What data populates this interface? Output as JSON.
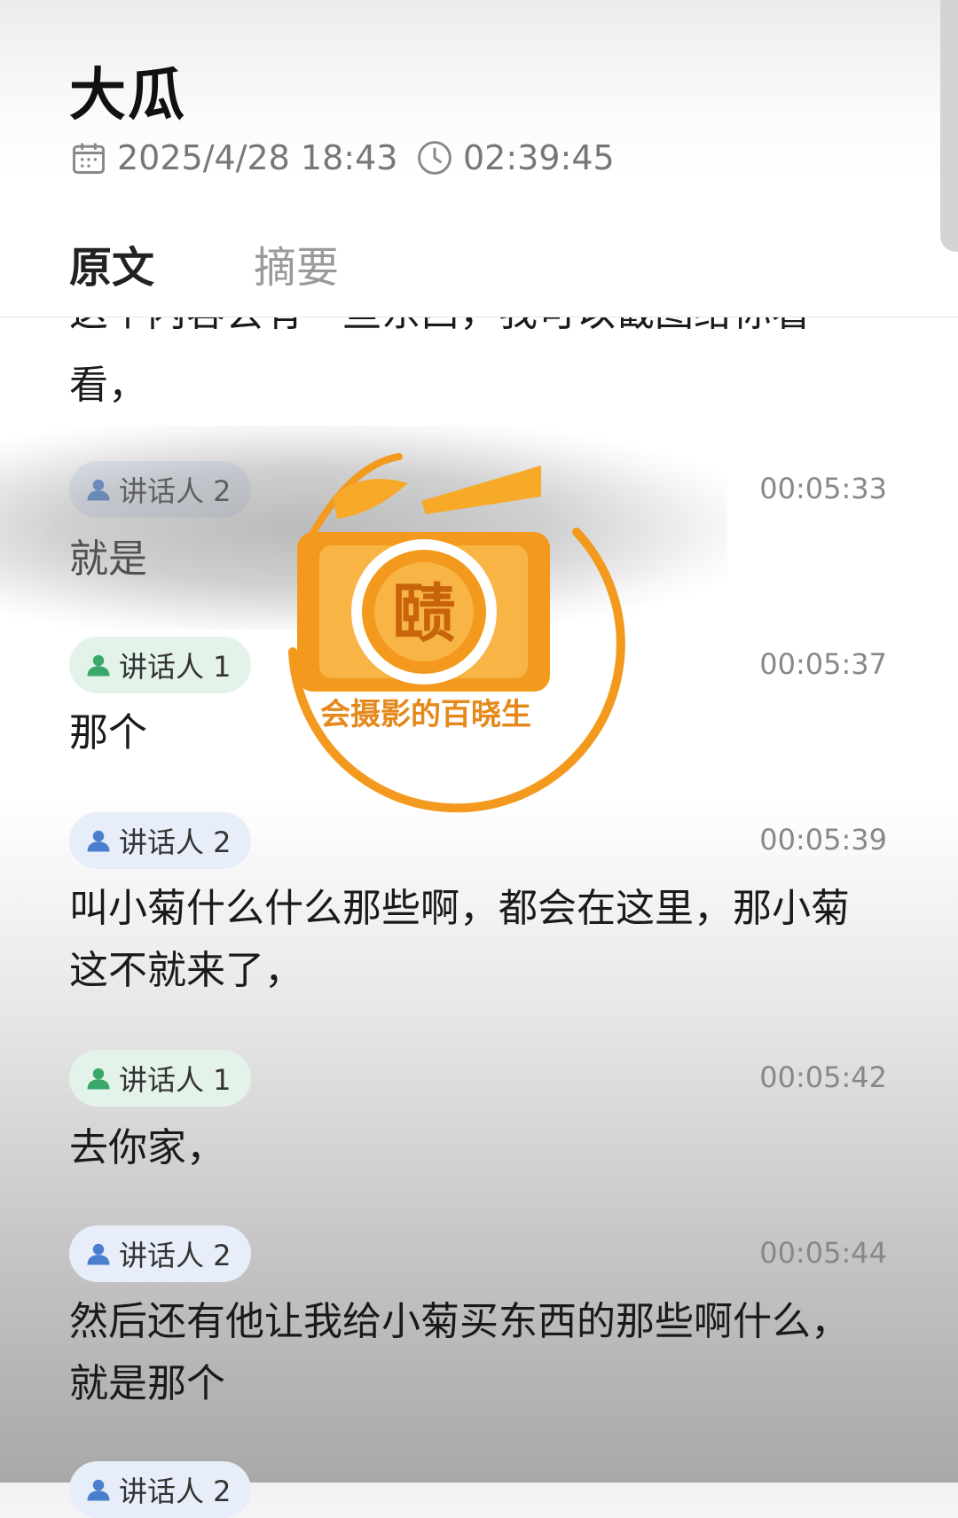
{
  "header": {
    "title": "大瓜",
    "datetime": "2025/4/28 18:43",
    "duration": "02:39:45"
  },
  "tabs": [
    {
      "label": "原文",
      "active": true
    },
    {
      "label": "摘要",
      "active": false
    }
  ],
  "transcript": {
    "cut_top_text": "这个内容会有一些东西，我可以截图给你看",
    "first_text": "看，",
    "entries": [
      {
        "speaker": "讲话人 2",
        "time": "00:05:33",
        "text": "就是"
      },
      {
        "speaker": "讲话人 1",
        "time": "00:05:37",
        "text": "那个"
      },
      {
        "speaker": "讲话人 2",
        "time": "00:05:39",
        "text": "叫小菊什么什么那些啊，都会在这里，那小菊这不就来了，"
      },
      {
        "speaker": "讲话人 1",
        "time": "00:05:42",
        "text": "去你家，"
      },
      {
        "speaker": "讲话人 2",
        "time": "00:05:44",
        "text": "然后还有他让我给小菊买东西的那些啊什么，就是那个"
      }
    ],
    "partial_speaker": "讲话人 2"
  },
  "watermark": {
    "text": "会摄影的百晓生",
    "seal_char": "赜"
  },
  "colors": {
    "speaker1_bg": "#e4f3ea",
    "speaker1_icon": "#3aa86b",
    "speaker2_bg": "#e7eef9",
    "speaker2_icon": "#4a7fd0",
    "watermark_orange": "#f39a1e"
  }
}
